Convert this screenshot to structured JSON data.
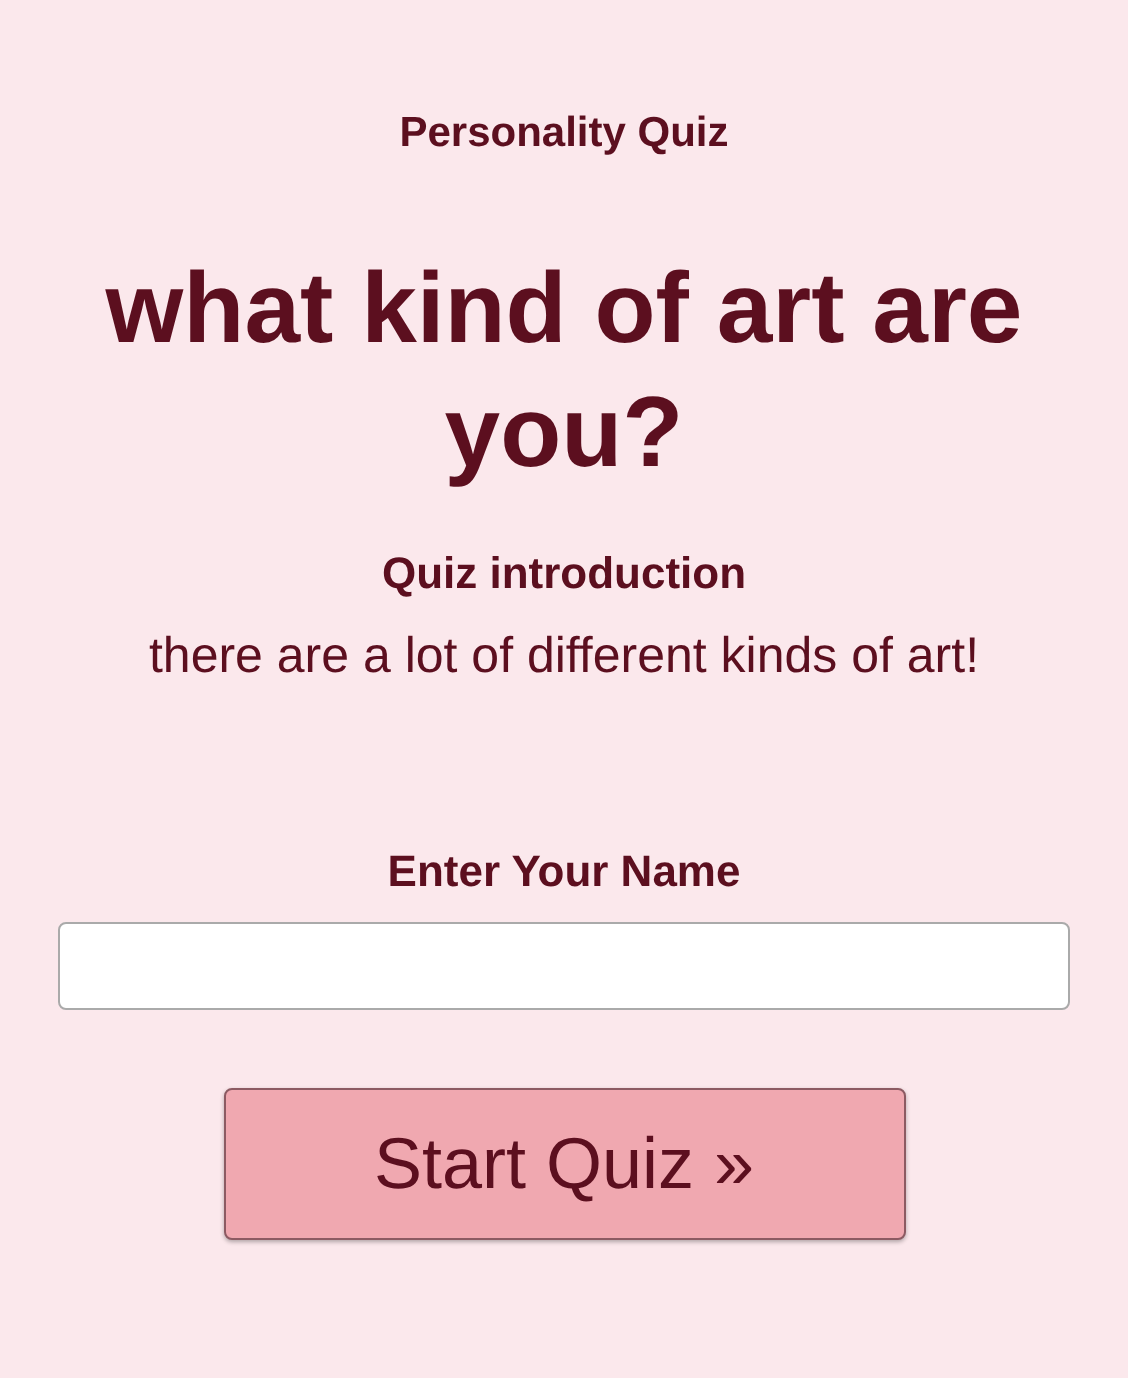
{
  "quiz_label": "Personality Quiz",
  "title": "what kind of art are you?",
  "intro": {
    "heading": "Quiz introduction",
    "text": "there are a lot of different kinds of art!"
  },
  "name_field": {
    "label": "Enter Your Name"
  },
  "start_button": {
    "label": "Start Quiz »"
  }
}
